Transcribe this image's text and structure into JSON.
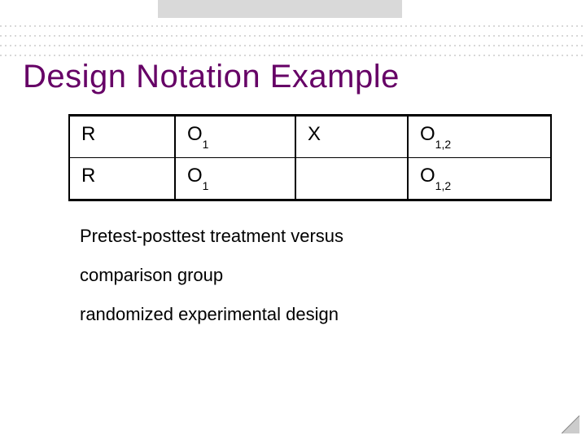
{
  "title": "Design Notation Example",
  "table": {
    "rows": [
      {
        "c0": "R",
        "c1": {
          "base": "O",
          "sub": "1"
        },
        "c2": "X",
        "c3": {
          "base": "O",
          "sub": "1,2"
        }
      },
      {
        "c0": "R",
        "c1": {
          "base": "O",
          "sub": "1"
        },
        "c2": "",
        "c3": {
          "base": "O",
          "sub": "1,2"
        }
      }
    ]
  },
  "caption": {
    "line1": "Pretest-posttest treatment versus",
    "line2": "comparison group",
    "line3": "randomized experimental design"
  }
}
